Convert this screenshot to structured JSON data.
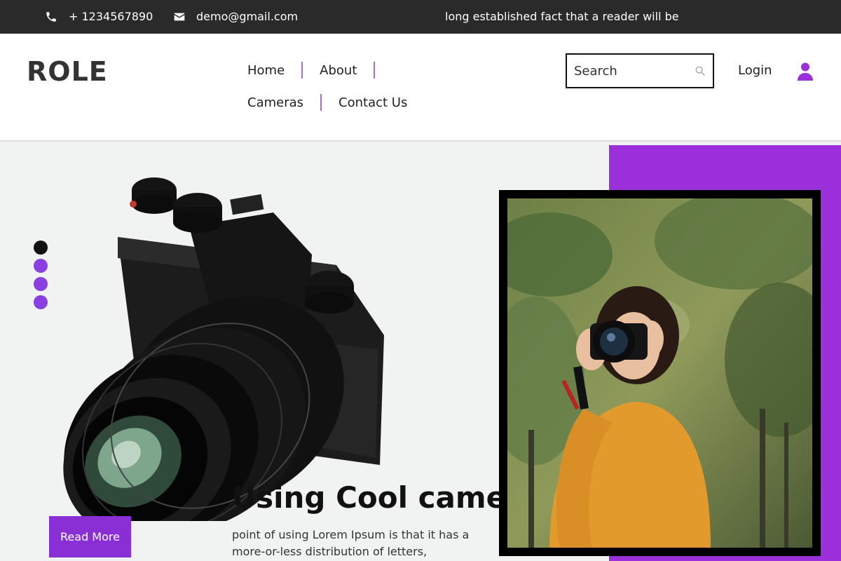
{
  "topbar": {
    "phone": "+ 1234567890",
    "email": "demo@gmail.com",
    "tagline": "long established fact that a reader will be"
  },
  "header": {
    "logo": "ROLE",
    "nav": [
      {
        "label": "Home"
      },
      {
        "label": "About"
      },
      {
        "label": "Cameras"
      },
      {
        "label": "Contact Us"
      }
    ],
    "search_placeholder": "Search",
    "login_label": "Login"
  },
  "hero": {
    "title": "Using Cool camera",
    "text": "point of using Lorem Ipsum is that it has a more-or-less distribution of letters,",
    "read_more_label": "Read More",
    "active_slide": 1,
    "slide_count": 4
  },
  "icons": {
    "phone": "phone-icon",
    "email": "envelope-icon",
    "search": "search-icon",
    "user": "user-icon"
  },
  "colors": {
    "accent": "#9b2fd9",
    "button": "#8a2fd6",
    "topbar": "#2a2a2a",
    "nav_separator": "#a26fd8"
  }
}
